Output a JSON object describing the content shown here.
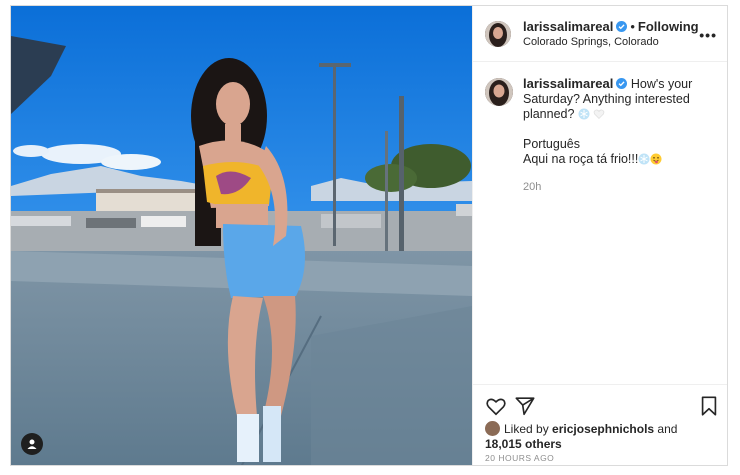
{
  "post": {
    "username": "larissalimareal",
    "follow_label": "Following",
    "separator": "•",
    "location": "Colorado Springs, Colorado",
    "more_label": "•••",
    "caption_line1": "How's your Saturday? Anything interested planned?",
    "caption_line2": "Português",
    "caption_line3": "Aqui na roça tá frio!!!",
    "caption_time": "20h",
    "liked_by_prefix": "Liked by",
    "liked_by_user": "ericjosephnichols",
    "liked_by_and": "and",
    "likes_others": "18,015 others",
    "posted_ago": "20 HOURS AGO"
  },
  "icons": {
    "verified": "verified-badge-icon",
    "like": "heart-icon",
    "share": "paper-plane-icon",
    "save": "bookmark-icon",
    "tag": "user-tag-icon"
  },
  "colors": {
    "verified_blue": "#3897f0",
    "meta_gray": "#8e8e8e",
    "sky": "#1a7fe0"
  }
}
